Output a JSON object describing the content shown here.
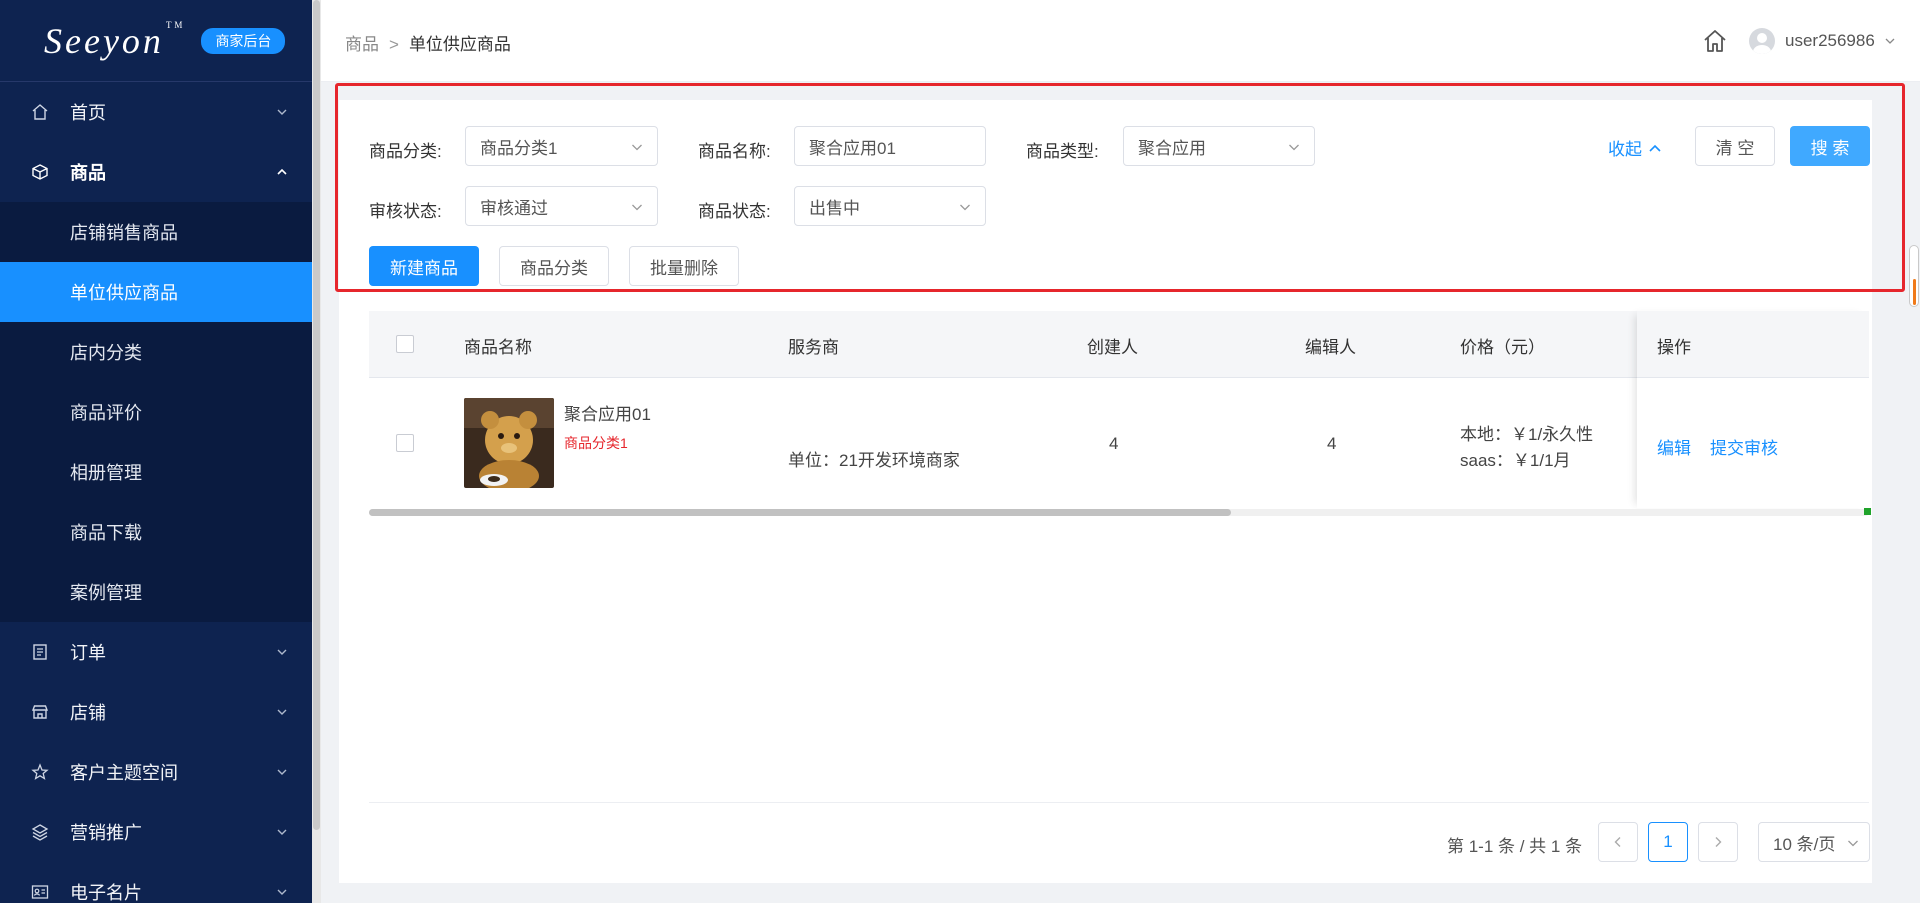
{
  "sidebar": {
    "logo": "Seeyon",
    "logo_tm": "TM",
    "badge": "商家后台",
    "nav": [
      {
        "label": "首页",
        "icon": "home-icon"
      },
      {
        "label": "商品",
        "icon": "cube-icon"
      },
      {
        "label": "订单",
        "icon": "document-icon"
      },
      {
        "label": "店铺",
        "icon": "store-icon"
      },
      {
        "label": "客户主题空间",
        "icon": "star-icon"
      },
      {
        "label": "营销推广",
        "icon": "layers-icon"
      },
      {
        "label": "电子名片",
        "icon": "id-card-icon"
      }
    ],
    "sub_items": [
      "店铺销售商品",
      "单位供应商品",
      "店内分类",
      "商品评价",
      "相册管理",
      "商品下载",
      "案例管理"
    ]
  },
  "header": {
    "breadcrumb": [
      "商品",
      "单位供应商品"
    ],
    "breadcrumb_sep": ">",
    "username": "user256986"
  },
  "filters": {
    "category_label": "商品分类:",
    "category_value": "商品分类1",
    "name_label": "商品名称:",
    "name_value": "聚合应用01",
    "type_label": "商品类型:",
    "type_value": "聚合应用",
    "audit_label": "审核状态:",
    "audit_value": "审核通过",
    "status_label": "商品状态:",
    "status_value": "出售中",
    "collapse_label": "收起",
    "clear_label": "清 空",
    "search_label": "搜 索"
  },
  "actions": {
    "new_label": "新建商品",
    "category_label": "商品分类",
    "batch_delete_label": "批量删除"
  },
  "table": {
    "columns": [
      "商品名称",
      "服务商",
      "创建人",
      "编辑人",
      "价格（元）",
      "操作"
    ],
    "rows": [
      {
        "name": "聚合应用01",
        "category": "商品分类1",
        "provider": "单位：21开发环境商家",
        "creator": "4",
        "editor": "4",
        "price_local": "本地：￥1/永久性",
        "price_saas": "saas：￥1/1月",
        "edit_label": "编辑",
        "submit_label": "提交审核"
      }
    ]
  },
  "pagination": {
    "total_text": "第 1-1 条 / 共 1 条",
    "current_page": "1",
    "page_size": "10 条/页"
  },
  "colors": {
    "sidebar_bg": "#0e2350",
    "primary": "#1890ff",
    "highlight_border": "#e6262c",
    "category_red": "#e6262c"
  }
}
